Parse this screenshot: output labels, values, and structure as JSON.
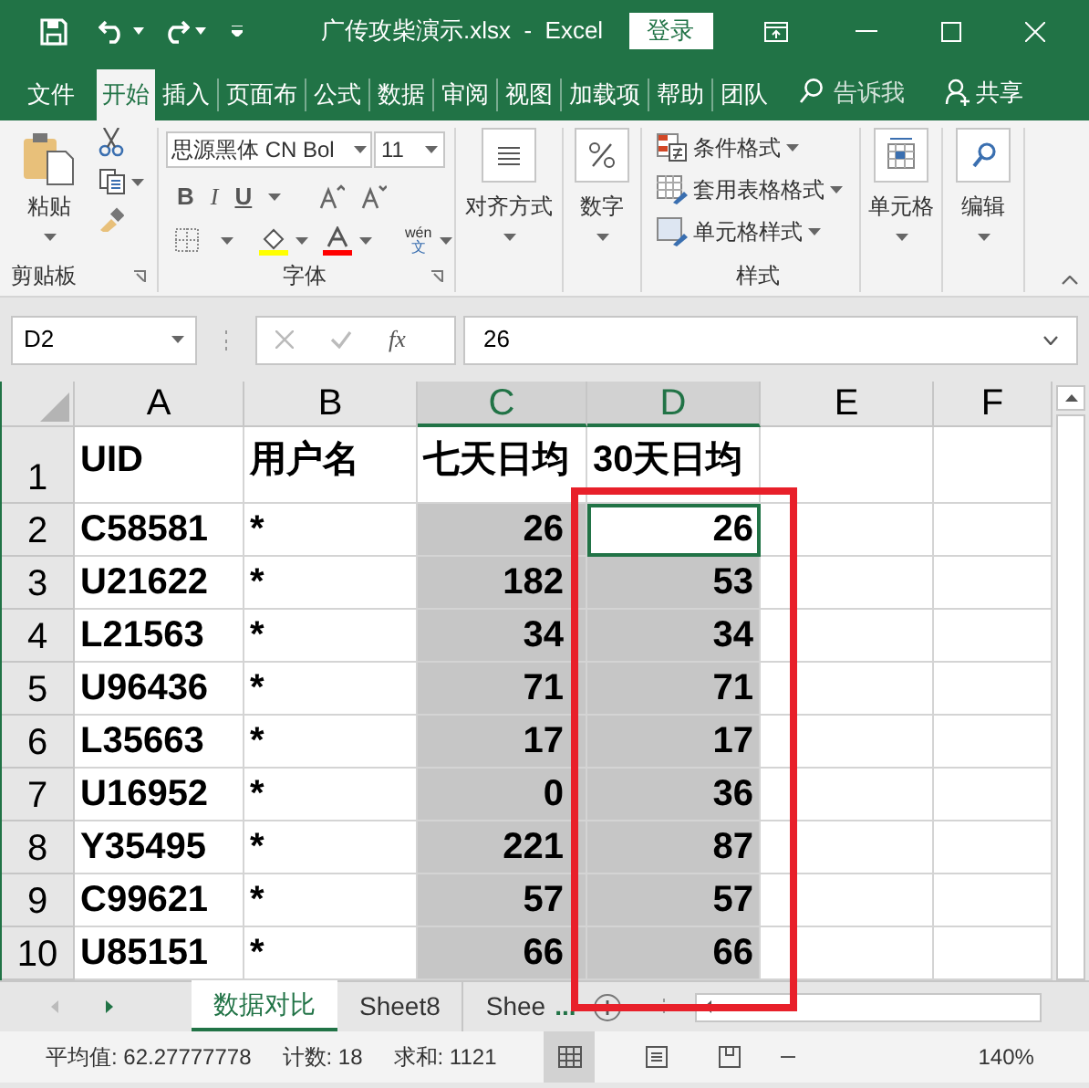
{
  "title_bar": {
    "title": "广传攻柴演示.xlsx  -  Excel",
    "login_button": "登录"
  },
  "menu_tabs": [
    {
      "label": "文件",
      "selected": false
    },
    {
      "label": "开始",
      "selected": true
    },
    {
      "label": "插入",
      "selected": false
    },
    {
      "label": "页面布",
      "selected": false
    },
    {
      "label": "公式",
      "selected": false
    },
    {
      "label": "数据",
      "selected": false
    },
    {
      "label": "审阅",
      "selected": false
    },
    {
      "label": "视图",
      "selected": false
    },
    {
      "label": "加载项",
      "selected": false
    },
    {
      "label": "帮助",
      "selected": false
    },
    {
      "label": "团队",
      "selected": false
    }
  ],
  "tell_me": "告诉我",
  "share": "共享",
  "ribbon": {
    "clipboard": {
      "paste": "粘贴",
      "label": "剪贴板"
    },
    "font": {
      "font_name": "思源黑体 CN Bol",
      "font_size": "11",
      "bold": "B",
      "italic": "I",
      "underline": "U",
      "phonetic_top": "wén",
      "phonetic_bottom": "文",
      "label": "字体"
    },
    "alignment": "对齐方式",
    "number": "数字",
    "styles": {
      "items": [
        "条件格式",
        "套用表格格式",
        "单元格样式"
      ],
      "label": "样式"
    },
    "cells": "单元格",
    "editing": "编辑"
  },
  "formula_bar": {
    "name_box": "D2",
    "fx": "fx",
    "value": "26"
  },
  "sheet": {
    "columns": [
      {
        "label": "A",
        "selected": false,
        "active": false
      },
      {
        "label": "B",
        "selected": false,
        "active": false
      },
      {
        "label": "C",
        "selected": true,
        "active": false
      },
      {
        "label": "D",
        "selected": true,
        "active": true
      },
      {
        "label": "E",
        "selected": false,
        "active": false
      },
      {
        "label": "F",
        "selected": false,
        "active": false
      }
    ],
    "rows": [
      {
        "number": "1",
        "selected": false,
        "active": false,
        "cells": [
          "UID",
          "用户名",
          "七天日均",
          "30天日均"
        ]
      },
      {
        "number": "2",
        "selected": true,
        "active": true,
        "cells": [
          "C58581",
          "*",
          "26",
          "26"
        ]
      },
      {
        "number": "3",
        "selected": true,
        "active": false,
        "cells": [
          "U21622",
          "*",
          "182",
          "53"
        ]
      },
      {
        "number": "4",
        "selected": true,
        "active": false,
        "cells": [
          "L21563",
          "*",
          "34",
          "34"
        ]
      },
      {
        "number": "5",
        "selected": true,
        "active": false,
        "cells": [
          "U96436",
          "*",
          "71",
          "71"
        ]
      },
      {
        "number": "6",
        "selected": true,
        "active": false,
        "cells": [
          "L35663",
          "*",
          "17",
          "17"
        ]
      },
      {
        "number": "7",
        "selected": true,
        "active": false,
        "cells": [
          "U16952",
          "*",
          "0",
          "36"
        ]
      },
      {
        "number": "8",
        "selected": true,
        "active": false,
        "cells": [
          "Y35495",
          "*",
          "221",
          "87"
        ]
      },
      {
        "number": "9",
        "selected": true,
        "active": false,
        "cells": [
          "C99621",
          "*",
          "57",
          "57"
        ]
      },
      {
        "number": "10",
        "selected": true,
        "active": false,
        "cells": [
          "U85151",
          "*",
          "66",
          "66"
        ]
      }
    ]
  },
  "sheet_tabs": [
    {
      "label": "数据对比",
      "selected": true
    },
    {
      "label": "Sheet8",
      "selected": false
    },
    {
      "label": "Shee",
      "selected": false
    }
  ],
  "more_sheets": "...",
  "status_bar": {
    "average": "平均值: 62.27777778",
    "count": "计数: 18",
    "sum": "求和: 1121",
    "zoom": "140%"
  }
}
